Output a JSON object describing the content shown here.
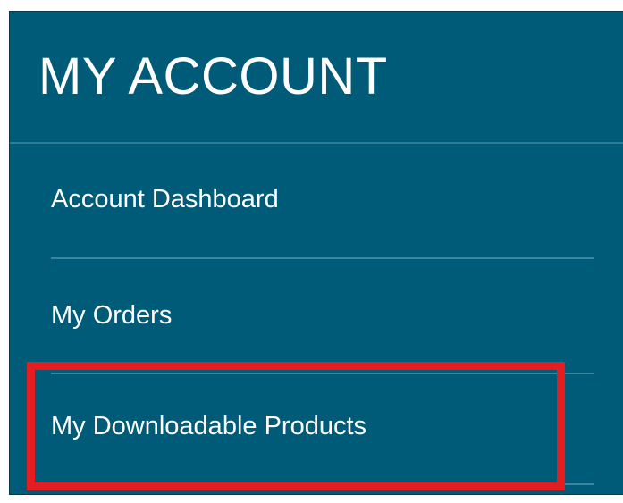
{
  "account_menu": {
    "title": "MY ACCOUNT",
    "items": [
      {
        "label": "Account Dashboard"
      },
      {
        "label": "My Orders"
      },
      {
        "label": "My Downloadable Products",
        "highlighted": true
      }
    ]
  },
  "colors": {
    "panel_background": "#005b78",
    "divider": "#3a869e",
    "highlight_border": "#e41e20",
    "text": "#ffffff"
  }
}
